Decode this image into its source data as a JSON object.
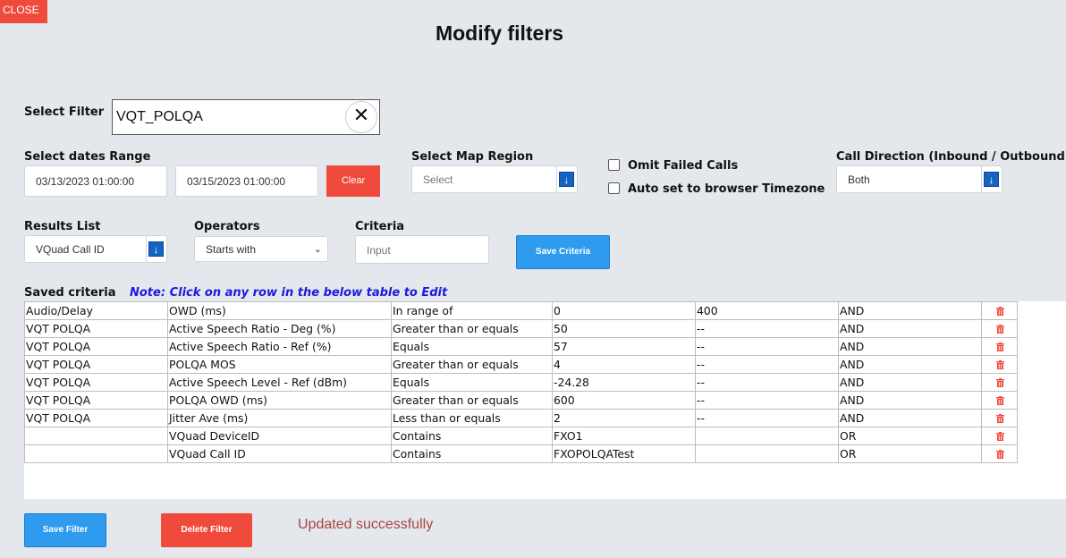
{
  "close_label": "CLOSE",
  "title": "Modify filters",
  "select_filter": {
    "label": "Select Filter",
    "value": "VQT_POLQA",
    "clear_icon": "close-icon"
  },
  "dates": {
    "label": "Select dates Range",
    "start": "03/13/2023 01:00:00",
    "end": "03/15/2023 01:00:00",
    "clear_label": "Clear"
  },
  "map_region": {
    "label": "Select Map Region",
    "placeholder": "Select"
  },
  "options": {
    "omit_failed": "Omit Failed Calls",
    "auto_tz": "Auto set to browser Timezone"
  },
  "direction": {
    "label": "Call Direction (Inbound / Outbound)",
    "value": "Both"
  },
  "results_list": {
    "label": "Results List",
    "value": "VQuad Call ID"
  },
  "operators": {
    "label": "Operators",
    "value": "Starts with"
  },
  "criteria": {
    "label": "Criteria",
    "placeholder": "Input"
  },
  "save_criteria_label": "Save Criteria",
  "saved": {
    "label": "Saved criteria",
    "note": "Note: Click on any row in the below table to Edit",
    "rows": [
      [
        "Audio/Delay",
        "OWD (ms)",
        "In range of",
        "0",
        "400",
        "AND"
      ],
      [
        "VQT POLQA",
        "Active Speech Ratio - Deg (%)",
        "Greater than or equals",
        "50",
        "--",
        "AND"
      ],
      [
        "VQT POLQA",
        "Active Speech Ratio - Ref (%)",
        "Equals",
        "57",
        "--",
        "AND"
      ],
      [
        "VQT POLQA",
        "POLQA MOS",
        "Greater than or equals",
        "4",
        "--",
        "AND"
      ],
      [
        "VQT POLQA",
        "Active Speech Level - Ref (dBm)",
        "Equals",
        "-24.28",
        "--",
        "AND"
      ],
      [
        "VQT POLQA",
        "POLQA OWD (ms)",
        "Greater than or equals",
        "600",
        "--",
        "AND"
      ],
      [
        "VQT POLQA",
        "Jitter Ave (ms)",
        "Less than or equals",
        "2",
        "--",
        "AND"
      ],
      [
        "",
        "VQuad DeviceID",
        "Contains",
        "FXO1",
        "",
        "OR"
      ],
      [
        "",
        "VQuad Call ID",
        "Contains",
        "FXOPOLQATest",
        "",
        "OR"
      ]
    ]
  },
  "footer": {
    "save_filter": "Save Filter",
    "delete_filter": "Delete Filter",
    "status": "Updated successfully"
  },
  "colors": {
    "red": "#f04a3c",
    "blue": "#2e9bee",
    "note": "#1a1ae0",
    "status": "#a94442"
  }
}
